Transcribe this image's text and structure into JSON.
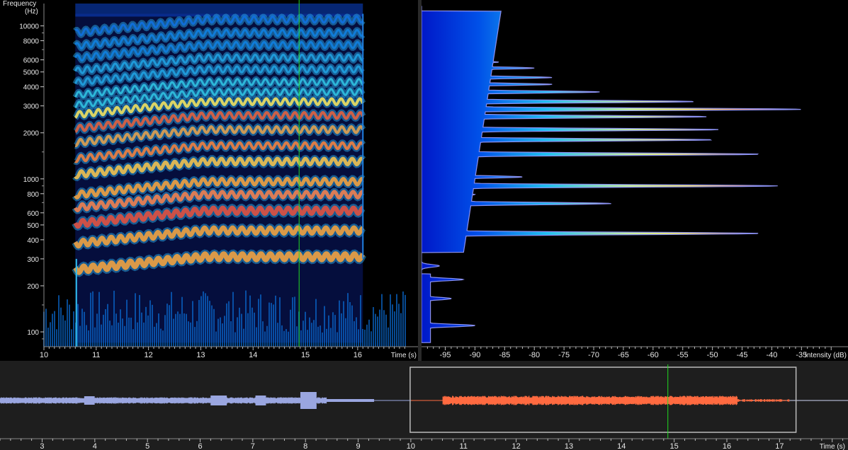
{
  "spectrogram": {
    "freq_axis_label_line1": "Frequency",
    "freq_axis_label_line2": "(Hz)",
    "freq_ticks": [
      10000,
      8000,
      6000,
      5000,
      4000,
      3000,
      2000,
      1000,
      800,
      600,
      500,
      400,
      300,
      200,
      100
    ],
    "freq_tick_labels": [
      "10000",
      "8000",
      "6000",
      "5000",
      "4000",
      "3000",
      "2000",
      "1000",
      "800",
      "600",
      "500",
      "400",
      "300",
      "200",
      "100"
    ],
    "time_ticks": [
      10,
      11,
      12,
      13,
      14,
      15,
      16
    ],
    "time_tick_labels": [
      "10",
      "11",
      "12",
      "13",
      "14",
      "15",
      "16"
    ],
    "time_axis_label": "Time (s)",
    "time_range": [
      10,
      16.95
    ],
    "freq_range": [
      80,
      14000
    ],
    "cursor_time": 14.88
  },
  "spectrum": {
    "intensity_ticks": [
      -95,
      -90,
      -85,
      -80,
      -75,
      -70,
      -65,
      -60,
      -55,
      -50,
      -45,
      -40,
      -35
    ],
    "intensity_tick_labels": [
      "-95",
      "-90",
      "-85",
      "-80",
      "-75",
      "-70",
      "-65",
      "-60",
      "-55",
      "-50",
      "-45",
      "-40",
      "-35"
    ],
    "intensity_axis_label": "Intensity (dB)",
    "intensity_range": [
      -99,
      -28
    ]
  },
  "overview": {
    "time_ticks": [
      3,
      4,
      5,
      6,
      7,
      8,
      9,
      10,
      11,
      12,
      13,
      14,
      15,
      16,
      17
    ],
    "time_tick_labels": [
      "3",
      "4",
      "5",
      "6",
      "7",
      "8",
      "9",
      "10",
      "11",
      "12",
      "13",
      "14",
      "15",
      "16",
      "17"
    ],
    "time_axis_label": "Time (s)",
    "time_range": [
      2.2,
      18.3
    ],
    "selection_start": 10,
    "selection_end": 17.3,
    "cursor_time": 14.88
  },
  "colors": {
    "background": "#000000",
    "panel_bg": "#1e1e1e",
    "cursor": "#22dd22",
    "waveform_unselected": "#9aa6e0",
    "waveform_selected": "#ff6a40",
    "selection_border": "#bbbbbb"
  }
}
